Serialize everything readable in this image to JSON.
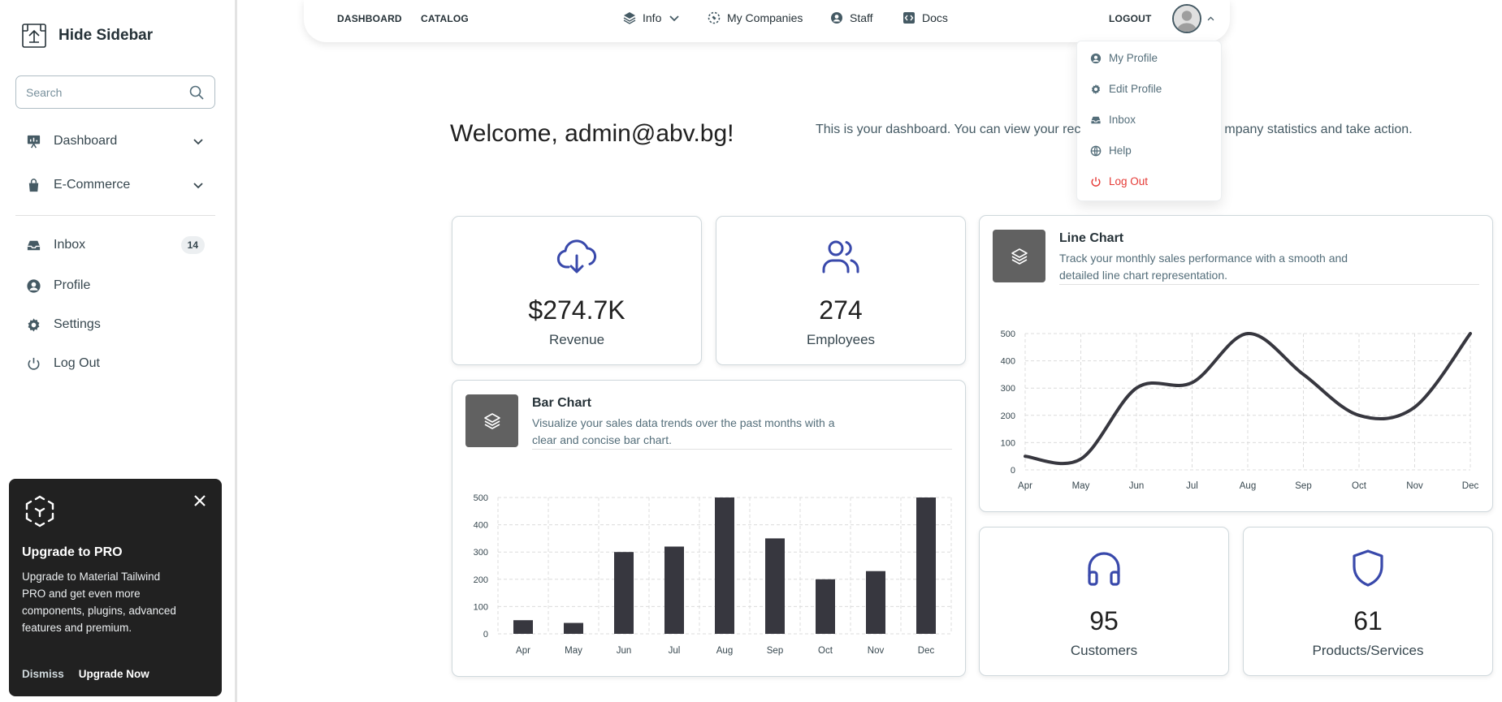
{
  "sidebar": {
    "brand": "Hide Sidebar",
    "search_placeholder": "Search",
    "items": [
      {
        "label": "Dashboard"
      },
      {
        "label": "E-Commerce"
      },
      {
        "label": "Inbox",
        "badge": "14"
      },
      {
        "label": "Profile"
      },
      {
        "label": "Settings"
      },
      {
        "label": "Log Out"
      }
    ],
    "promo": {
      "title": "Upgrade to PRO",
      "text": "Upgrade to Material Tailwind PRO and get even more components, plugins, advanced features and premium.",
      "dismiss": "Dismiss",
      "upgrade": "Upgrade Now"
    }
  },
  "topnav": {
    "links": [
      "DASHBOARD",
      "CATALOG"
    ],
    "info": "Info",
    "companies": "My Companies",
    "staff": "Staff",
    "docs": "Docs",
    "logout": "LOGOUT"
  },
  "profile_menu": {
    "items": [
      "My Profile",
      "Edit Profile",
      "Inbox",
      "Help",
      "Log Out"
    ]
  },
  "main": {
    "welcome": "Welcome, admin@abv.bg!",
    "subtext": "This is your dashboard. You can view your rec",
    "subtext_end": "mpany statistics and take action."
  },
  "stats": [
    {
      "value": "$274.7K",
      "label": "Revenue"
    },
    {
      "value": "274",
      "label": "Employees"
    },
    {
      "value": "95",
      "label": "Customers"
    },
    {
      "value": "61",
      "label": "Products/Services"
    }
  ],
  "bar_card": {
    "title": "Bar Chart",
    "desc": "Visualize your sales data trends over the past months with a clear and concise bar chart."
  },
  "line_card": {
    "title": "Line Chart",
    "desc": "Track your monthly sales performance with a smooth and detailed line chart representation."
  },
  "colors": {
    "accent": "#3949ab",
    "bar": "#37373f",
    "danger": "#e53935"
  },
  "chart_data": [
    {
      "type": "bar",
      "categories": [
        "Apr",
        "May",
        "Jun",
        "Jul",
        "Aug",
        "Sep",
        "Oct",
        "Nov",
        "Dec"
      ],
      "values": [
        50,
        40,
        300,
        320,
        500,
        350,
        200,
        230,
        500
      ],
      "yticks": [
        0,
        100,
        200,
        300,
        400,
        500
      ],
      "ylim": [
        0,
        500
      ],
      "grid": true
    },
    {
      "type": "line",
      "categories": [
        "Apr",
        "May",
        "Jun",
        "Jul",
        "Aug",
        "Sep",
        "Oct",
        "Nov",
        "Dec"
      ],
      "values": [
        50,
        40,
        300,
        320,
        500,
        350,
        200,
        230,
        500
      ],
      "yticks": [
        0,
        100,
        200,
        300,
        400,
        500
      ],
      "ylim": [
        0,
        500
      ],
      "grid": true
    }
  ]
}
